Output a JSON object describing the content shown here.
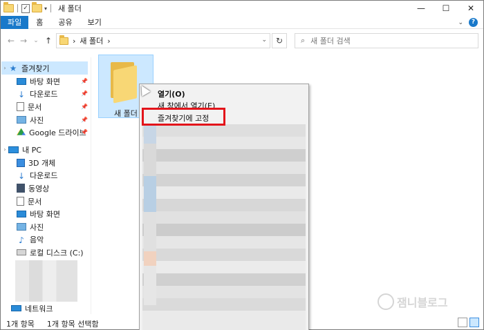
{
  "window": {
    "title": "새 폴더",
    "controls": {
      "minimize": "—",
      "maximize": "☐",
      "close": "✕"
    }
  },
  "ribbon": {
    "tabs": [
      {
        "label": "파일",
        "active": true
      },
      {
        "label": "홈",
        "active": false
      },
      {
        "label": "공유",
        "active": false
      },
      {
        "label": "보기",
        "active": false
      }
    ],
    "accent": "#1979ca"
  },
  "nav": {
    "back": "←",
    "forward": "→",
    "recent": "⌄",
    "up": "↑",
    "breadcrumb_sep": "›",
    "breadcrumb": "새 폴더",
    "refresh": "↻"
  },
  "search": {
    "placeholder": "새 폴더 검색"
  },
  "sidebar": {
    "quick_access": "즐겨찾기",
    "quick_items": [
      "바탕 화면",
      "다운로드",
      "문서",
      "사진",
      "Google 드라이브"
    ],
    "this_pc": "내 PC",
    "pc_items": [
      "3D 개체",
      "다운로드",
      "동영상",
      "문서",
      "바탕 화면",
      "사진",
      "음악",
      "로컬 디스크 (C:)"
    ],
    "network": "네트워크"
  },
  "content": {
    "items": [
      {
        "name": "새 폴더",
        "selected": true
      }
    ]
  },
  "context_menu": {
    "items": [
      {
        "label": "열기(O)",
        "bold": true
      },
      {
        "label": "새 창에서 열기(E)",
        "bold": false
      },
      {
        "label": "즐겨찾기에 고정",
        "bold": false,
        "highlighted": true
      }
    ],
    "highlight_color": "#e3141a"
  },
  "status": {
    "count": "1개 항목",
    "selected": "1개 항목 선택함"
  },
  "watermark": {
    "text": "잼니블로그"
  }
}
